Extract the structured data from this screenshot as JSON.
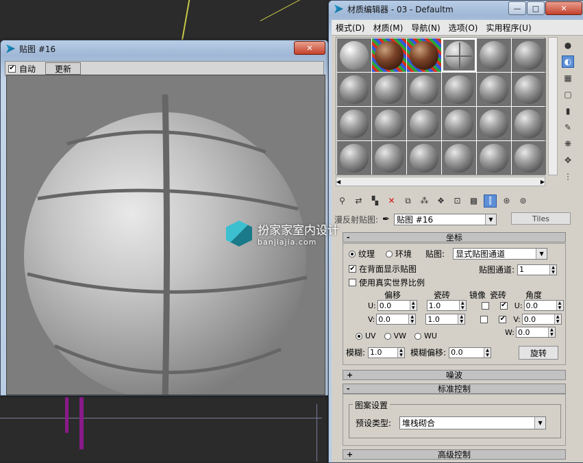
{
  "material_editor": {
    "title": "材质编辑器 - 03 - Defaultm",
    "menus": [
      "模式(D)",
      "材质(M)",
      "导航(N)",
      "选项(O)",
      "实用程序(U)"
    ],
    "map_label": "漫反射贴图:",
    "map_name": "贴图 #16",
    "map_type": "Tiles",
    "coords": {
      "header": "坐标",
      "radio_texture": "纹理",
      "radio_env": "环境",
      "map_label": "贴图:",
      "map_select": "显式贴图通道",
      "show_back": "在背面显示贴图",
      "channel_label": "贴图通道:",
      "channel_value": "1",
      "real_world": "使用真实世界比例",
      "col_offset": "偏移",
      "col_tiling": "瓷砖",
      "col_mirror": "镜像",
      "col_tile": "瓷砖",
      "col_angle": "角度",
      "u": "U:",
      "v": "V:",
      "w": "W:",
      "u_offset": "0.0",
      "v_offset": "0.0",
      "u_tiling": "1.0",
      "v_tiling": "1.0",
      "angle_u": "0.0",
      "angle_v": "0.0",
      "angle_w": "0.0",
      "uv": "UV",
      "vw": "VW",
      "wu": "WU",
      "blur_label": "模糊:",
      "blur_value": "1.0",
      "blur_offset_label": "模糊偏移:",
      "blur_offset_value": "0.0",
      "rotate_btn": "旋转"
    },
    "noise_header": "噪波",
    "std_header": "标准控制",
    "pattern_group": "图案设置",
    "preset_label": "预设类型:",
    "preset_value": "堆栈砌合",
    "adv_header": "高级控制"
  },
  "map_window": {
    "title": "贴图 #16",
    "auto_label": "自动",
    "update_label": "更新"
  },
  "watermark": {
    "title": "扮家家室内设计",
    "sub": "banjiajia.com"
  }
}
